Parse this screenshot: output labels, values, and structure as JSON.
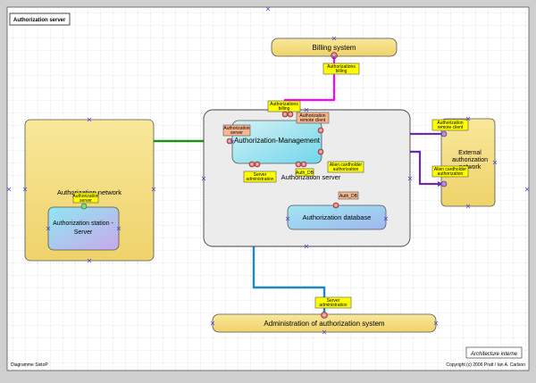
{
  "page": {
    "title": "Authorization server",
    "footer_left": "Diagramme SixtoP",
    "footer_right": "Copyright (c) 2006 Pratt / Ian A. Carlson",
    "stamp": "Architecture interne"
  },
  "nodes": {
    "billing": "Billing system",
    "auth_network": "Authorization network",
    "auth_station": "Authorization station - Server",
    "auth_server": "Authorization server",
    "auth_mgmt": "Authorization-Management",
    "auth_db": "Authorization database",
    "external": "External authorization network",
    "admin": "Administration of authorization system"
  },
  "interfaces": {
    "auth_billing_top": "Authorizations billing",
    "auth_billing_mid": "Authorizations billing",
    "remote_client_inner": "Authorization remote client",
    "auth_server_iface": "Authorization server",
    "alien_inner": "Alien cardholder authorization",
    "auth_db_a": "Auth_DB",
    "auth_db_b": "Auth_DB",
    "server_admin_mid": "Server administration",
    "server_admin_bottom": "Server administration",
    "station_server": "Authorization server",
    "remote_client_ext": "Authorization remote client",
    "alien_ext": "Alien cardholder authorization"
  },
  "colors": {
    "pink": "#ff00ff",
    "green_dark": "#1f8f1f",
    "green_light": "#44dd44",
    "purple": "#6f2aa8",
    "blue": "#1f86c8",
    "block_fill": "#f3dc7e",
    "mgmt_fill": "#8fe4f0"
  }
}
